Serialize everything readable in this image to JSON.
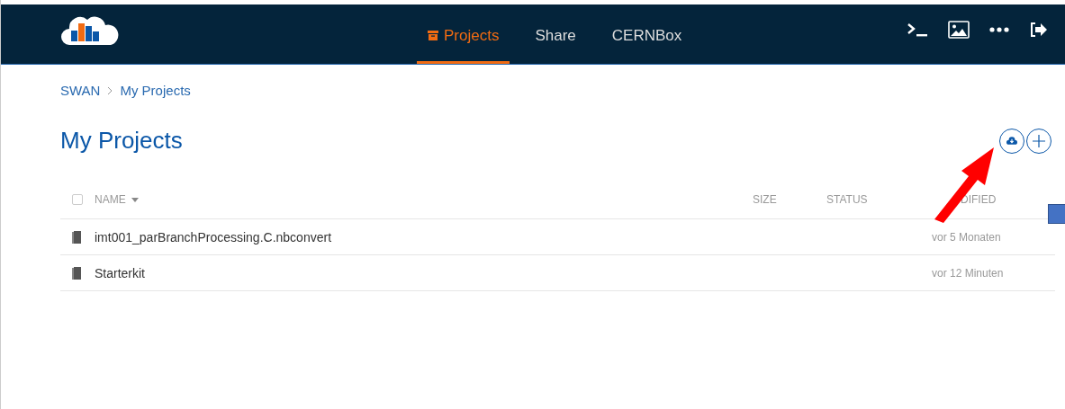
{
  "nav": {
    "tabs": [
      {
        "label": "Projects",
        "selected": true
      },
      {
        "label": "Share",
        "selected": false
      },
      {
        "label": "CERNBox",
        "selected": false
      }
    ]
  },
  "breadcrumb": [
    "SWAN",
    "My Projects"
  ],
  "page_title": "My Projects",
  "table": {
    "select_all": {
      "checked": false
    },
    "columns": [
      "NAME",
      "SIZE",
      "STATUS",
      "DIFIED"
    ],
    "rows": [
      {
        "name": "imt001_parBranchProcessing.C.nbconvert",
        "modified": "vor 5 Monaten"
      },
      {
        "name": "Starterkit",
        "modified": "vor 12 Minuten"
      }
    ]
  }
}
